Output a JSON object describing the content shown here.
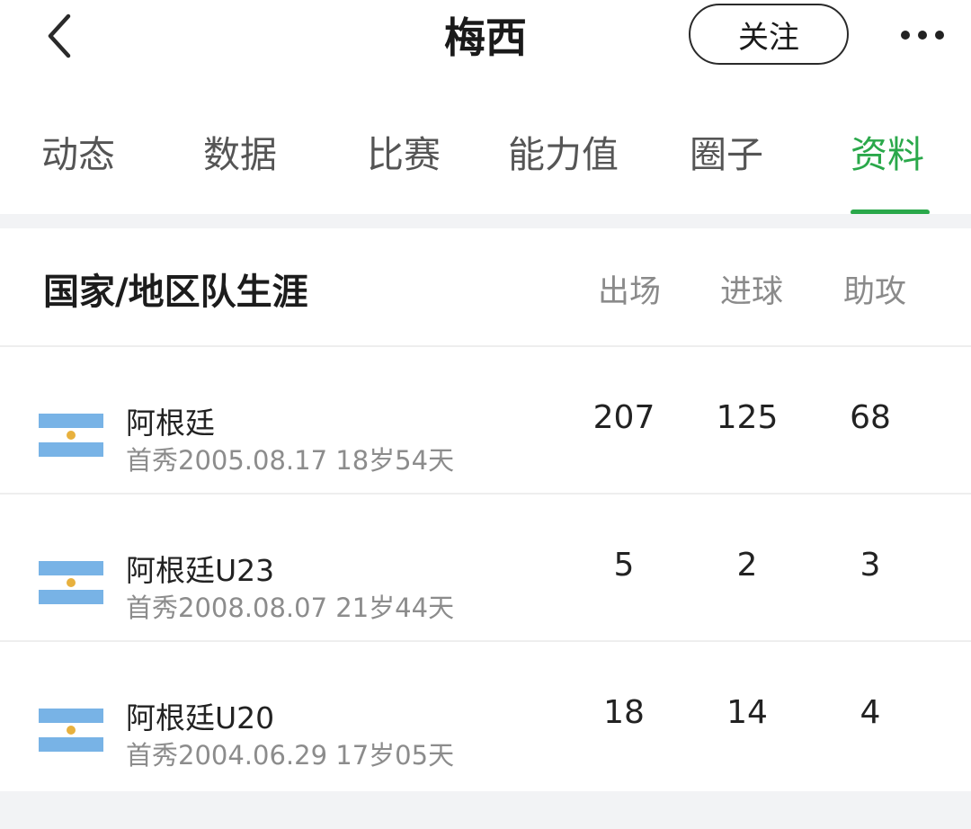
{
  "header": {
    "back_icon": "chevron-left-icon",
    "title": "梅西",
    "follow_label": "关注",
    "more_icon": "more-horizontal-icon"
  },
  "tabs": [
    {
      "label": "动态",
      "active": false
    },
    {
      "label": "数据",
      "active": false
    },
    {
      "label": "比赛",
      "active": false
    },
    {
      "label": "能力值",
      "active": false
    },
    {
      "label": "圈子",
      "active": false
    },
    {
      "label": "资料",
      "active": true
    }
  ],
  "colors": {
    "accent": "#2aa84a",
    "flag_blue": "#78b3e6",
    "flag_sun": "#e8b13e"
  },
  "career": {
    "title": "国家/地区队生涯",
    "columns": [
      "出场",
      "进球",
      "助攻"
    ],
    "rows": [
      {
        "flag_icon": "argentina-flag-icon",
        "team": "阿根廷",
        "debut": "首秀2005.08.17 18岁54天",
        "apps": "207",
        "goals": "125",
        "assists": "68"
      },
      {
        "flag_icon": "argentina-flag-icon",
        "team": "阿根廷U23",
        "debut": "首秀2008.08.07 21岁44天",
        "apps": "5",
        "goals": "2",
        "assists": "3"
      },
      {
        "flag_icon": "argentina-flag-icon",
        "team": "阿根廷U20",
        "debut": "首秀2004.06.29 17岁05天",
        "apps": "18",
        "goals": "14",
        "assists": "4"
      }
    ]
  }
}
